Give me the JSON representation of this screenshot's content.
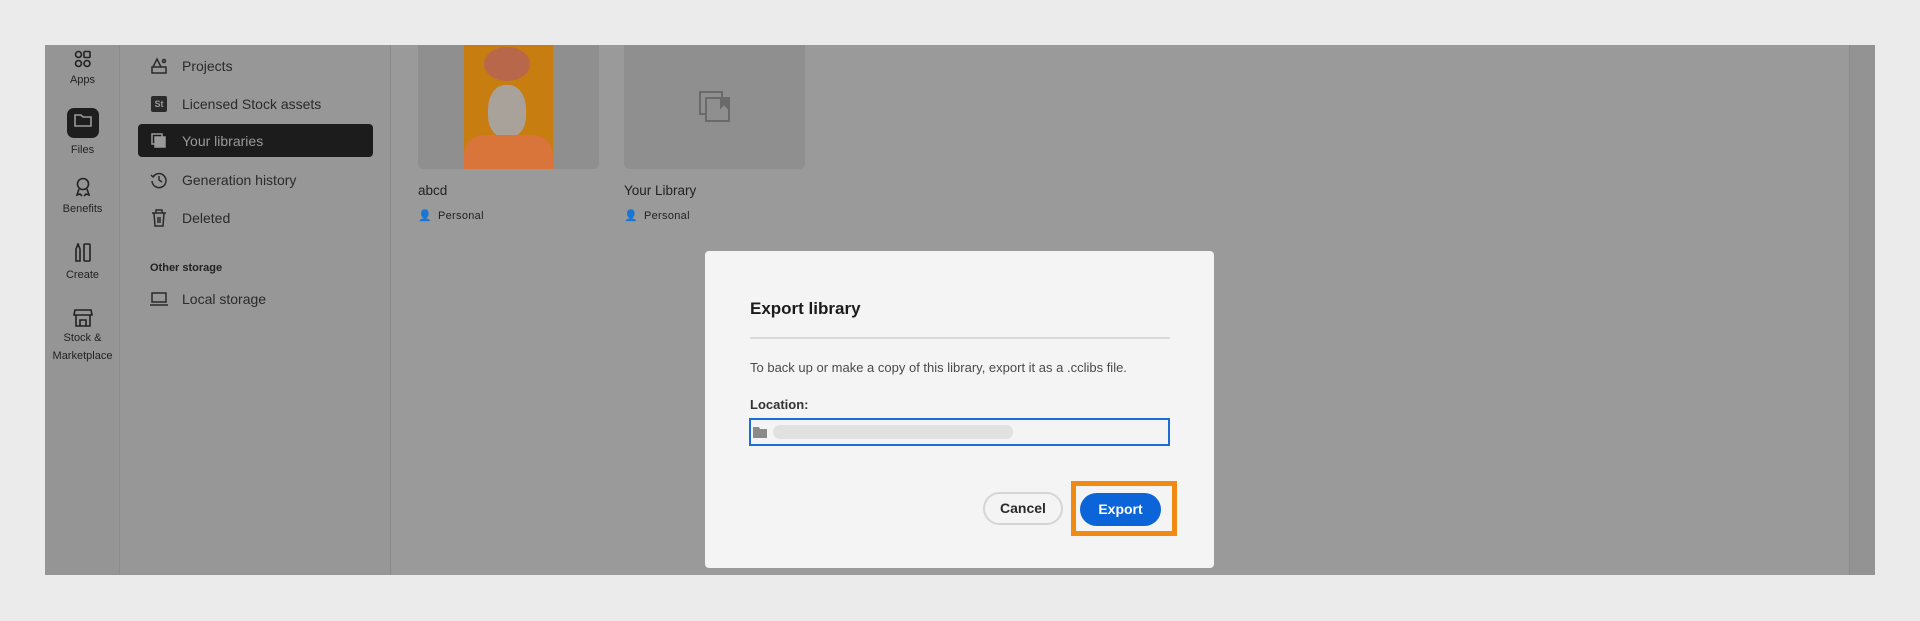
{
  "rail": {
    "items": [
      {
        "label": "Apps",
        "icon": "apps-icon"
      },
      {
        "label": "Files",
        "icon": "folder-icon"
      },
      {
        "label": "Benefits",
        "icon": "award-icon"
      },
      {
        "label": "Create",
        "icon": "create-icon"
      },
      {
        "label": "Stock &",
        "label2": "Marketplace",
        "icon": "store-icon"
      }
    ]
  },
  "sidebar": {
    "items": [
      {
        "label": "Projects"
      },
      {
        "label": "Licensed Stock assets",
        "badge": "St"
      },
      {
        "label": "Your libraries"
      },
      {
        "label": "Generation history"
      },
      {
        "label": "Deleted"
      }
    ],
    "other_heading": "Other storage",
    "local_storage": "Local storage"
  },
  "libraries": [
    {
      "title": "abcd",
      "owner": "Personal"
    },
    {
      "title": "Your Library",
      "owner": "Personal"
    }
  ],
  "dialog": {
    "title": "Export library",
    "body": "To back up or make a copy of this library, export it as a .cclibs file.",
    "location_label": "Location:",
    "cancel": "Cancel",
    "export": "Export",
    "highlight_color": "#f08a13",
    "accent": "#0b65d8"
  }
}
